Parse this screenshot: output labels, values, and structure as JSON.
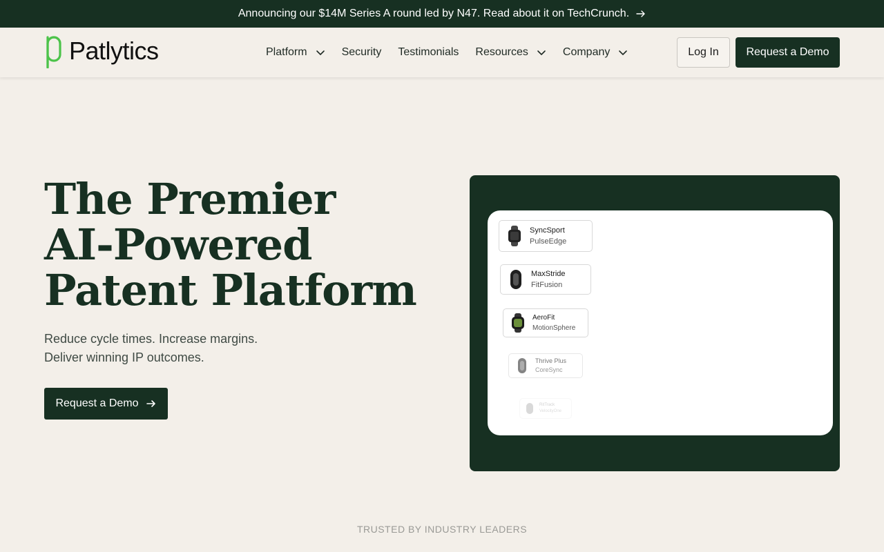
{
  "announcement": {
    "text": "Announcing our $14M Series A round led by N47. Read about it on TechCrunch.",
    "icon": "arrow-right-icon"
  },
  "nav": {
    "logo_text": "Patlytics",
    "links": [
      {
        "label": "Platform",
        "dropdown": true
      },
      {
        "label": "Security",
        "dropdown": false
      },
      {
        "label": "Testimonials",
        "dropdown": false
      },
      {
        "label": "Resources",
        "dropdown": true
      },
      {
        "label": "Company",
        "dropdown": true
      }
    ],
    "login_label": "Log In",
    "demo_label": "Request a Demo"
  },
  "hero": {
    "title_lines": [
      "The Premier",
      "AI-Powered",
      "Patent Platform"
    ],
    "subtitle_lines": [
      "Reduce cycle times. Increase margins.",
      "Deliver winning IP outcomes."
    ],
    "cta_label": "Request a Demo"
  },
  "products": [
    {
      "name": "SyncSport",
      "sub": "PulseEdge"
    },
    {
      "name": "MaxStride",
      "sub": "FitFusion"
    },
    {
      "name": "AeroFit",
      "sub": "MotionSphere"
    },
    {
      "name": "Thrive Plus",
      "sub": "CoreSync"
    },
    {
      "name": "RitTrack",
      "sub": "VelocityOne"
    }
  ],
  "trusted_label": "TRUSTED BY INDUSTRY LEADERS",
  "colors": {
    "brand_dark": "#173022",
    "background": "#f3efe9",
    "logo_green": "#4cc34a"
  }
}
